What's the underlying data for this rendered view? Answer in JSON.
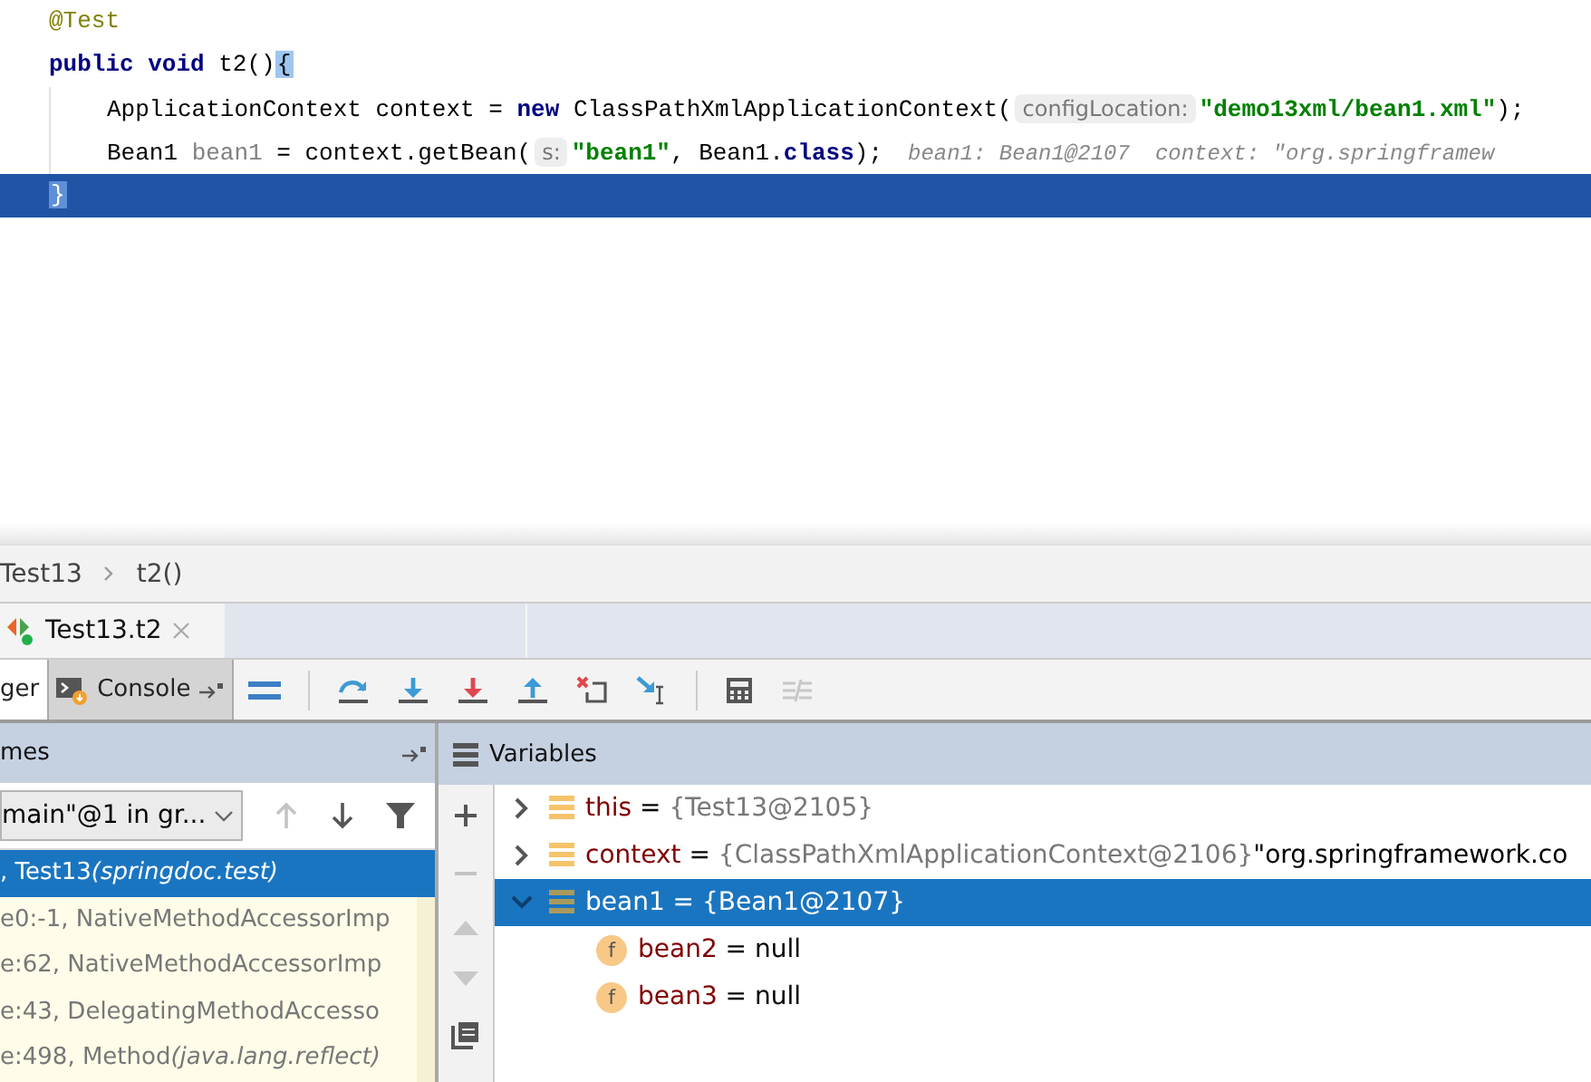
{
  "editor": {
    "lines": [
      {
        "current": false,
        "indent": false,
        "tokens": [
          {
            "kind": "annotation",
            "text": "@Test"
          }
        ]
      },
      {
        "current": false,
        "indent": false,
        "tokens": [
          {
            "kind": "keyword",
            "text": "public void"
          },
          {
            "kind": "plain",
            "text": " t2()"
          },
          {
            "kind": "brace",
            "text": "{"
          }
        ]
      },
      {
        "current": false,
        "indent": true,
        "tokens": [
          {
            "kind": "plain",
            "text": "ApplicationContext context = "
          },
          {
            "kind": "keyword",
            "text": "new"
          },
          {
            "kind": "plain",
            "text": " ClassPathXmlApplicationContext("
          },
          {
            "kind": "hint",
            "text": "configLocation:"
          },
          {
            "kind": "string",
            "text": "\"demo13xml/bean1.xml\""
          },
          {
            "kind": "plain",
            "text": ");"
          }
        ]
      },
      {
        "current": false,
        "indent": true,
        "tokens": [
          {
            "kind": "plain",
            "text": "Bean1 "
          },
          {
            "kind": "unused",
            "text": "bean1"
          },
          {
            "kind": "plain",
            "text": " = context.getBean("
          },
          {
            "kind": "hint",
            "text": "s:"
          },
          {
            "kind": "string",
            "text": "\"bean1\""
          },
          {
            "kind": "plain",
            "text": ", Bean1."
          },
          {
            "kind": "keyword",
            "text": "class"
          },
          {
            "kind": "plain",
            "text": ");"
          },
          {
            "kind": "inline",
            "text": "bean1: Bean1@2107"
          },
          {
            "kind": "inline",
            "text": "context: \"org.springframew"
          }
        ]
      },
      {
        "current": true,
        "indent": false,
        "tokens": [
          {
            "kind": "brace",
            "text": "}"
          }
        ]
      }
    ]
  },
  "breadcrumb": [
    "Test13",
    "t2()"
  ],
  "session_tabs": [
    {
      "label": "Test13.t2",
      "selected": true
    }
  ],
  "tool_tabs": [
    {
      "label": "ger",
      "selected": true,
      "kind": "debugger"
    },
    {
      "label": "Console",
      "selected": false,
      "kind": "console"
    }
  ],
  "frames": {
    "title": "mes",
    "thread": "main\"@1 in gr...",
    "items": [
      {
        "location": ", Test13",
        "package": "(springdoc.test)",
        "selected": true
      },
      {
        "location": "e0:-1, NativeMethodAccessorImp",
        "selected": false
      },
      {
        "location": "e:62, NativeMethodAccessorImp",
        "selected": false
      },
      {
        "location": "e:43, DelegatingMethodAccesso",
        "selected": false
      },
      {
        "location": "e:498, Method",
        "package": "(java.lang.reflect)",
        "selected": false
      }
    ]
  },
  "variables": {
    "title": "Variables",
    "items": [
      {
        "kind": "object",
        "name": "this",
        "op": "=",
        "value": "{Test13@2105}",
        "selected": false,
        "expanded": false
      },
      {
        "kind": "object",
        "name": "context",
        "op": "=",
        "value": "{ClassPathXmlApplicationContext@2106}",
        "extra": "\"org.springframework.co",
        "selected": false,
        "expanded": false
      },
      {
        "kind": "object",
        "name": "bean1",
        "op": "=",
        "value": "{Bean1@2107}",
        "selected": true,
        "expanded": true,
        "children": [
          {
            "kind": "field",
            "badge": "f",
            "name": "bean2",
            "op": "=",
            "value": "null",
            "selected": false
          },
          {
            "kind": "field",
            "badge": "f",
            "name": "bean3",
            "op": "=",
            "value": "null",
            "selected": false
          }
        ]
      }
    ]
  }
}
